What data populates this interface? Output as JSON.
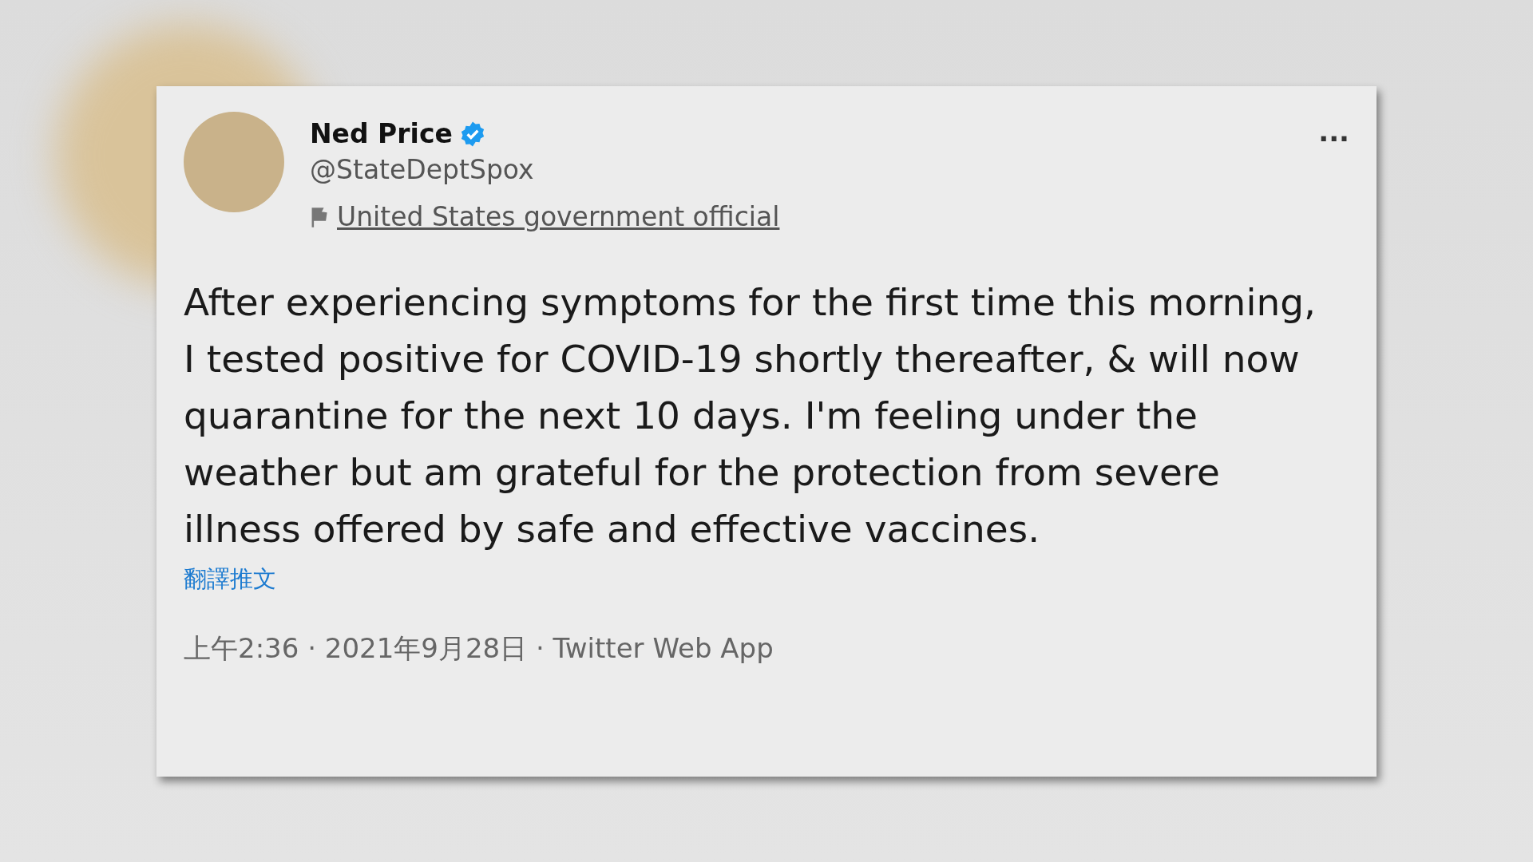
{
  "tweet": {
    "author": {
      "name": "Ned Price",
      "verified": true,
      "handle": "@StateDeptSpox",
      "label": "United States government official"
    },
    "more_button": "···",
    "text": "After experiencing symptoms for the first time this morning, I tested positive for COVID-19 shortly thereafter, & will now quarantine for the next 10 days. I'm feeling under the weather but am grateful for the protection from severe illness offered by safe and effective vaccines.",
    "translate_link": "翻譯推文",
    "meta": "上午2:36 · 2021年9月28日 · Twitter Web App"
  }
}
